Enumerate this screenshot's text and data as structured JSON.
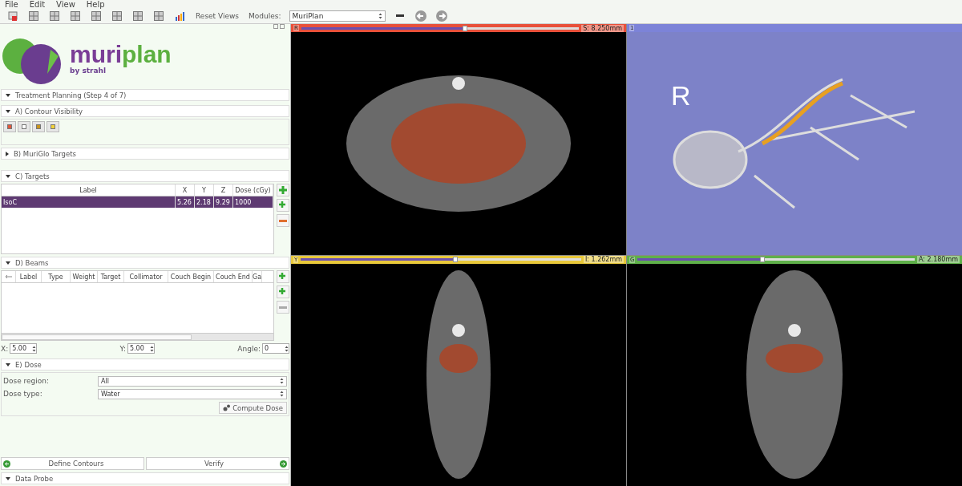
{
  "menu": [
    "File",
    "Edit",
    "View",
    "Help"
  ],
  "toolbar": {
    "tools": [
      {
        "kind": "load"
      },
      {
        "kind": "layout"
      },
      {
        "kind": "layout"
      },
      {
        "kind": "layout"
      },
      {
        "kind": "layout"
      },
      {
        "kind": "layout"
      },
      {
        "kind": "layout"
      },
      {
        "kind": "layout"
      },
      {
        "kind": "chart"
      }
    ],
    "reset_views": "Reset Views",
    "modules_label": "Modules:",
    "module": "MuriPlan"
  },
  "logo": {
    "wordmark": [
      "muri",
      "plan"
    ],
    "byline": "by",
    "brand": "strahl"
  },
  "panel": {
    "title": "Treatment Planning (Step 4 of 7)",
    "expanded": true
  },
  "contour_visibility": {
    "title": "A) Contour Visibility",
    "expanded": true,
    "toggles": [
      {
        "color": "#e0573c"
      },
      {
        "color": "#ffffff"
      },
      {
        "color": "#c8951e"
      },
      {
        "color": "#f2d23a"
      }
    ]
  },
  "muriglo_targets": {
    "title": "B) MuriGlo Targets",
    "expanded": false
  },
  "targets": {
    "title": "C) Targets",
    "expanded": true,
    "columns": [
      "Label",
      "X",
      "Y",
      "Z",
      "Dose (cGy)"
    ],
    "rows": [
      {
        "cells": [
          "IsoC",
          "5.26",
          "2.18",
          "9.29",
          "1000"
        ],
        "selected": true
      }
    ]
  },
  "beams": {
    "title": "D) Beams",
    "expanded": true,
    "columns": [
      "Label",
      "Type",
      "Weight",
      "Target",
      "Collimator",
      "Couch Begin",
      "Couch End",
      "Ga"
    ],
    "x": {
      "label": "X:",
      "value": "5.00"
    },
    "y": {
      "label": "Y:",
      "value": "5.00"
    },
    "angle": {
      "label": "Angle:",
      "value": "0"
    }
  },
  "dose": {
    "title": "E) Dose",
    "expanded": true,
    "fields": [
      {
        "label": "Dose region:",
        "value": "All"
      },
      {
        "label": "Dose type:",
        "value": "Water"
      }
    ],
    "button": "Compute Dose"
  },
  "nav": {
    "back": "Define Contours",
    "next": "Verify"
  },
  "data_probe": {
    "title": "Data Probe",
    "expanded": true
  },
  "views": [
    {
      "kind": "axial",
      "letter": "R",
      "color": "#e8503a",
      "level": 0.59,
      "reading": "S: 8.250mm"
    },
    {
      "kind": "volume",
      "letter": "1",
      "color": "#7c83d8",
      "annotation": "R"
    },
    {
      "kind": "sagittal",
      "letter": "Y",
      "color": "#e8c83a",
      "level": 0.55,
      "reading": "I: 1.262mm"
    },
    {
      "kind": "coronal",
      "letter": "G",
      "color": "#5fb04a",
      "level": 0.45,
      "reading": "A: 2.180mm"
    }
  ]
}
